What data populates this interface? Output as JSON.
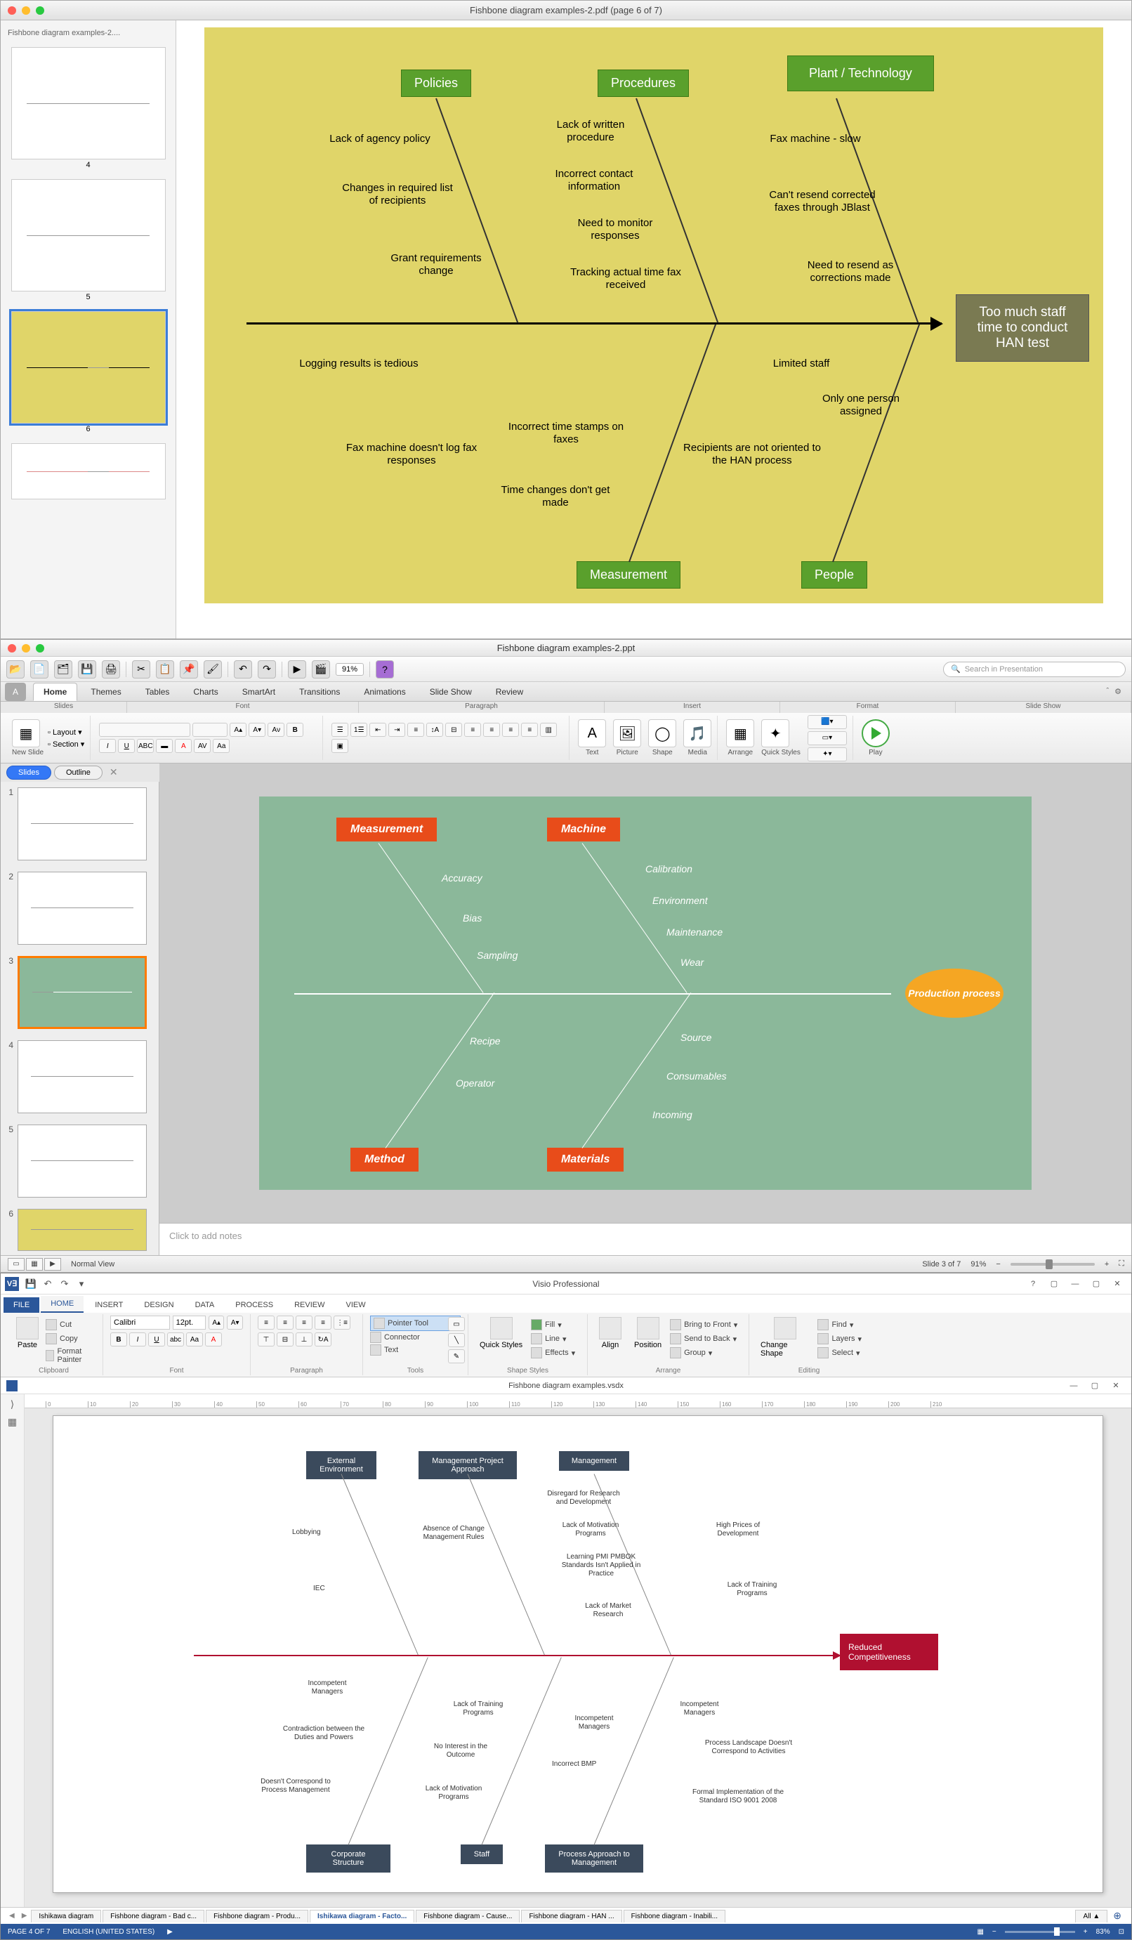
{
  "app1": {
    "window_title": "Fishbone diagram examples-2.pdf (page 6 of 7)",
    "sidebar_title": "Fishbone diagram examples-2....",
    "thumbs": [
      "4",
      "5",
      "6"
    ],
    "selected_thumb": "6",
    "diagram": {
      "categories_top": [
        "Policies",
        "Procedures",
        "Plant / Technology"
      ],
      "categories_bottom": [
        "Measurement",
        "People"
      ],
      "effect": "Too much staff time to conduct HAN test",
      "causes": {
        "policies": [
          "Lack of agency policy",
          "Changes in required list of recipients",
          "Grant requirements change"
        ],
        "procedures": [
          "Lack of written procedure",
          "Incorrect contact information",
          "Need to monitor responses",
          "Tracking actual time fax received"
        ],
        "plant": [
          "Fax machine - slow",
          "Can't resend corrected faxes through JBlast",
          "Need to resend as corrections made"
        ],
        "measurement": [
          "Logging results is tedious",
          "Fax machine doesn't log fax responses",
          "Incorrect time stamps on faxes",
          "Time changes don't get made"
        ],
        "people": [
          "Limited staff",
          "Only one person assigned",
          "Recipients are not oriented to the HAN process"
        ]
      }
    }
  },
  "app2": {
    "window_title": "Fishbone diagram examples-2.ppt",
    "search_placeholder": "Search in Presentation",
    "zoom_toolbar": "91%",
    "ribbon_tabs": [
      "A",
      "Home",
      "Themes",
      "Tables",
      "Charts",
      "SmartArt",
      "Transitions",
      "Animations",
      "Slide Show",
      "Review"
    ],
    "ribbon_groups": [
      "Slides",
      "Font",
      "Paragraph",
      "Insert",
      "Format",
      "Slide Show"
    ],
    "slides_group": {
      "new_slide": "New Slide",
      "layout": "Layout",
      "section": "Section"
    },
    "insert_items": [
      "Text",
      "Picture",
      "Shape",
      "Media"
    ],
    "format_items": [
      "Arrange",
      "Quick Styles"
    ],
    "slideshow_item": "Play",
    "panel_tabs": [
      "Slides",
      "Outline"
    ],
    "thumbs": [
      "1",
      "2",
      "3",
      "4",
      "5",
      "6"
    ],
    "selected_thumb": "3",
    "notes_placeholder": "Click to add notes",
    "status": {
      "view": "Normal View",
      "slide": "Slide 3 of 7",
      "zoom": "91%"
    },
    "diagram": {
      "categories_top": [
        "Measurement",
        "Machine"
      ],
      "categories_bottom": [
        "Method",
        "Materials"
      ],
      "effect": "Production process",
      "causes": {
        "measurement": [
          "Accuracy",
          "Bias",
          "Sampling"
        ],
        "machine": [
          "Calibration",
          "Environment",
          "Maintenance",
          "Wear"
        ],
        "method": [
          "Recipe",
          "Operator"
        ],
        "materials": [
          "Source",
          "Consumables",
          "Incoming"
        ]
      }
    }
  },
  "app3": {
    "window_title": "Visio Professional",
    "doc_title": "Fishbone diagram examples.vsdx",
    "ribbon_tabs": [
      "FILE",
      "HOME",
      "INSERT",
      "DESIGN",
      "DATA",
      "PROCESS",
      "REVIEW",
      "VIEW"
    ],
    "clipboard": {
      "paste": "Paste",
      "cut": "Cut",
      "copy": "Copy",
      "format_painter": "Format Painter",
      "label": "Clipboard"
    },
    "font": {
      "family": "Calibri",
      "size": "12pt.",
      "label": "Font"
    },
    "paragraph_label": "Paragraph",
    "tools": {
      "pointer": "Pointer Tool",
      "connector": "Connector",
      "text": "Text",
      "label": "Tools"
    },
    "shape_styles": {
      "quick": "Quick Styles",
      "fill": "Fill",
      "line": "Line",
      "effects": "Effects",
      "label": "Shape Styles"
    },
    "arrange": {
      "align": "Align",
      "position": "Position",
      "bring_front": "Bring to Front",
      "send_back": "Send to Back",
      "group": "Group",
      "label": "Arrange"
    },
    "editing": {
      "change_shape": "Change Shape",
      "find": "Find",
      "layers": "Layers",
      "select": "Select",
      "label": "Editing"
    },
    "sheet_tabs": [
      "Ishikawa diagram",
      "Fishbone diagram - Bad c...",
      "Fishbone diagram - Produ...",
      "Ishikawa diagram - Facto...",
      "Fishbone diagram - Cause...",
      "Fishbone diagram - HAN ...",
      "Fishbone diagram - Inabili..."
    ],
    "sheet_all": "All ▲",
    "active_sheet": 3,
    "status": {
      "page": "PAGE 4 OF 7",
      "lang": "ENGLISH (UNITED STATES)",
      "zoom": "83%"
    },
    "diagram": {
      "categories_top": [
        "External Environment",
        "Management Project Approach",
        "Management"
      ],
      "categories_bottom": [
        "Corporate Structure",
        "Staff",
        "Process Approach to Management"
      ],
      "effect": "Reduced Competitiveness",
      "causes": {
        "ext": [
          "Lobbying",
          "IEC"
        ],
        "mgmt_proj": [
          "Absence of Change Management Rules"
        ],
        "mgmt": [
          "Disregard for Research and Development",
          "Lack of Motivation Programs",
          "Learning PMI PMBOK Standards Isn't Applied in Practice",
          "Lack of Market Research",
          "High Prices of Development",
          "Lack of Training Programs"
        ],
        "corp": [
          "Incompetent Managers",
          "Contradiction between the Duties and Powers",
          "Doesn't Correspond to Process Management"
        ],
        "staff": [
          "Lack of Training Programs",
          "No Interest in the Outcome",
          "Lack of Motivation Programs"
        ],
        "process": [
          "Incompetent Managers",
          "Incorrect BMP",
          "Incompetent Managers",
          "Process Landscape Doesn't Correspond to Activities",
          "Formal Implementation of the Standard ISO 9001 2008"
        ]
      }
    }
  }
}
